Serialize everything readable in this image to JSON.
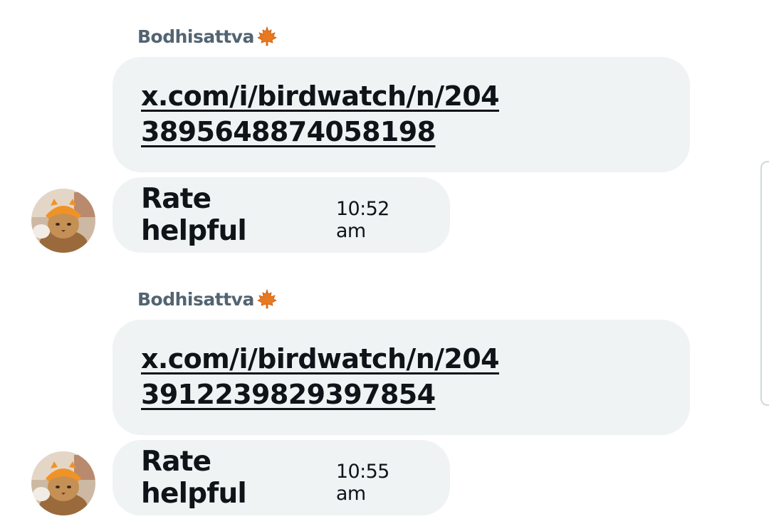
{
  "messages": [
    {
      "sender": "Bodhisattva",
      "sender_badge_icon": "maple-leaf-icon",
      "link": "x.com/i/birdwatch/n/2043895648874058198",
      "reply": "Rate helpful",
      "time": "10:52 am"
    },
    {
      "sender": "Bodhisattva",
      "sender_badge_icon": "maple-leaf-icon",
      "link": "x.com/i/birdwatch/n/2043912239829397854",
      "reply": "Rate helpful",
      "time": "10:55 am"
    }
  ],
  "colors": {
    "bubble_bg": "#eff3f4",
    "sender_name": "#536471",
    "text": "#0f1419",
    "leaf": "#e8791f"
  },
  "avatar_icon": "cat-avatar-icon"
}
